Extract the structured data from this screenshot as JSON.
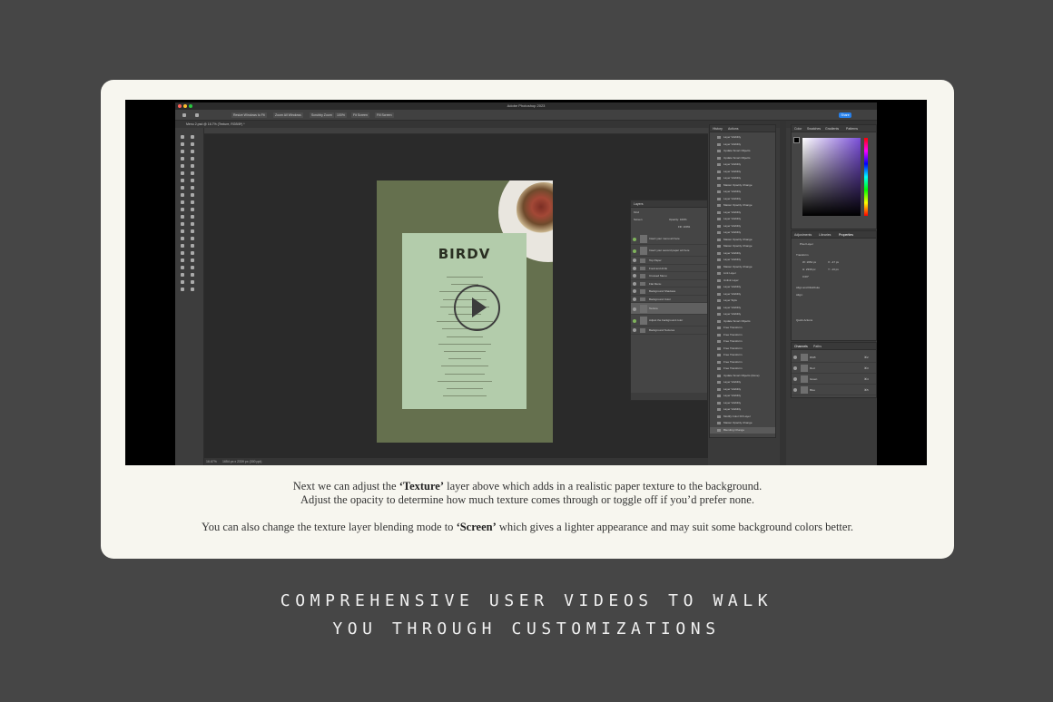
{
  "video": {
    "app": {
      "window_title": "Adobe Photoshop 2023",
      "doc_tab": "Menu 2.psd @ 16.7% (Texture, RGB/8*) *",
      "options": [
        "Resize Windows to Fit",
        "Zoom All Windows",
        "Scrubby Zoom",
        "100%",
        "Fit Screen",
        "Fill Screen"
      ],
      "share_label": "Share",
      "status_zoom": "16.67%",
      "status_size": "1654 px x 2339 px (300 ppi)",
      "menu_logo": "BIRDV",
      "history_tabs": [
        "History",
        "Actions"
      ],
      "history_items": [
        "Layer Visibility",
        "Layer Visibility",
        "Update Smart Objects",
        "Update Smart Objects",
        "Layer Visibility",
        "Layer Visibility",
        "Layer Visibility",
        "Master Opacity Change",
        "Layer Visibility",
        "Layer Visibility",
        "Master Opacity Change",
        "Layer Visibility",
        "Layer Visibility",
        "Layer Visibility",
        "Layer Visibility",
        "Master Opacity Change",
        "Master Opacity Change",
        "Layer Visibility",
        "Layer Visibility",
        "Master Opacity Change",
        "Link Layer",
        "Unlink Layer",
        "Layer Visibility",
        "Layer Visibility",
        "Layer Style",
        "Layer Visibility",
        "Layer Visibility",
        "Update Smart Objects",
        "Free Transform",
        "Free Transform",
        "Free Transform",
        "Free Transform",
        "Free Transform",
        "Free Transform",
        "Free Transform",
        "Update Smart Objects (Done)",
        "Layer Visibility",
        "Layer Visibility",
        "Layer Visibility",
        "Layer Visibility",
        "Layer Visibility",
        "Modify Color Fill Layer",
        "Master Opacity Change",
        "Blending Change"
      ],
      "layers_title": "Layers",
      "layers_kind": "Kind",
      "layers_mode": "Screen",
      "layers_opacity": "Opacity: 100%",
      "layers_fill": "Fill: 100%",
      "layers": [
        "Insert your menu art here",
        "Insert your second paper art here",
        "Top Paper",
        "Food and drink",
        "Crossed Menu",
        "Flat Menu",
        "Background Shadows",
        "Background Color",
        "Texture",
        "Adjust the background color",
        "Background Textures"
      ],
      "color_tabs": [
        "Color",
        "Swatches",
        "Gradients",
        "Patterns"
      ],
      "properties_tabs": [
        "Adjustments",
        "Libraries",
        "Properties"
      ],
      "properties_layer": "Pixel Layer",
      "properties_sections": [
        "Transform",
        "Align and Distribute",
        "Quick Actions"
      ],
      "properties_fields": [
        "W: 1654 px",
        "H: 2339 px",
        "X: -47 px",
        "Y: -13 px",
        "0.00°"
      ],
      "properties_align_label": "Align:",
      "channels_tabs": [
        "Channels",
        "Paths"
      ],
      "channels": [
        {
          "name": "RGB",
          "shortcut": "⌘2"
        },
        {
          "name": "Red",
          "shortcut": "⌘3"
        },
        {
          "name": "Green",
          "shortcut": "⌘4"
        },
        {
          "name": "Blue",
          "shortcut": "⌘5"
        }
      ]
    }
  },
  "caption": {
    "line1_pre": "Next we can adjust the ",
    "line1_bold": "‘Texture’",
    "line1_post": " layer above which adds in a realistic paper texture to the background.",
    "line2": "Adjust the opacity to determine how much texture comes through or toggle off if you’d prefer none.",
    "line3_pre": "You can also change the texture layer blending mode to ",
    "line3_bold": "‘Screen’",
    "line3_post": " which gives a lighter appearance and may suit some background colors better."
  },
  "headline": {
    "line1": "COMPREHENSIVE USER VIDEOS TO WALK",
    "line2": "YOU THROUGH CUSTOMIZATIONS"
  },
  "colors": {
    "background": "#464646",
    "card": "#f7f6ef",
    "menu_green": "#65704e",
    "paper_green": "#b3ccab",
    "selection_green": "#5b7a3b",
    "share_blue": "#2680eb"
  }
}
